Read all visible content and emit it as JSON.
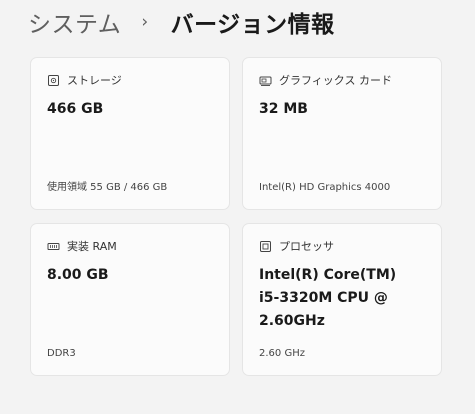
{
  "breadcrumb": {
    "parent": "システム",
    "separator": "›",
    "current": "バージョン情報"
  },
  "cards": {
    "storage": {
      "icon": "storage-icon",
      "label": "ストレージ",
      "value": "466 GB",
      "detail": "使用領域 55 GB / 466 GB"
    },
    "graphics": {
      "icon": "graphics-card-icon",
      "label": "グラフィックス カード",
      "value": "32 MB",
      "detail": "Intel(R) HD Graphics 4000"
    },
    "ram": {
      "icon": "memory-icon",
      "label": "実装 RAM",
      "value": "8.00 GB",
      "detail": "DDR3"
    },
    "processor": {
      "icon": "processor-icon",
      "label": "プロセッサ",
      "value": "Intel(R) Core(TM) i5-3320M CPU @ 2.60GHz",
      "detail": "2.60 GHz"
    }
  }
}
